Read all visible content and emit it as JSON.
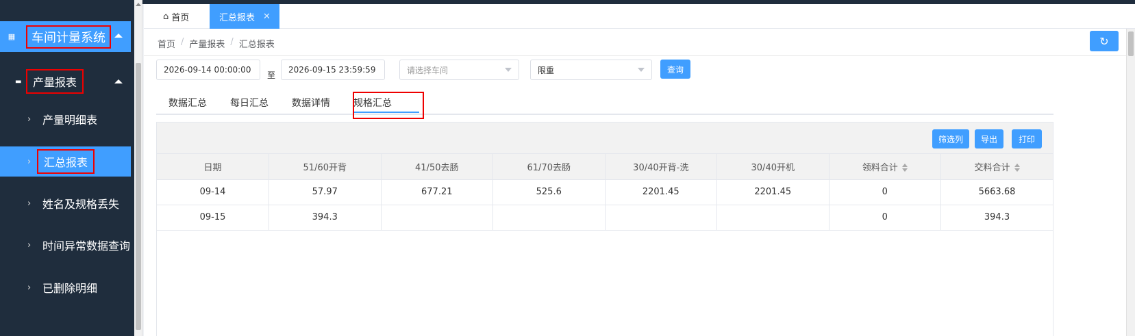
{
  "sidebar": {
    "system_title": "车间计量系统",
    "group_title": "产量报表",
    "items": [
      {
        "label": "产量明细表"
      },
      {
        "label": "汇总报表"
      },
      {
        "label": "姓名及规格丢失"
      },
      {
        "label": "时间异常数据查询"
      },
      {
        "label": "已删除明细"
      }
    ]
  },
  "tabs": {
    "home": "首页",
    "active": "汇总报表",
    "close": "✕"
  },
  "breadcrumb": [
    "首页",
    "产量报表",
    "汇总报表"
  ],
  "filters": {
    "start": "2026-09-14 00:00:00",
    "to_label": "至",
    "end": "2026-09-15 23:59:59",
    "workshop_placeholder": "请选择车间",
    "measure": "限重",
    "query_button": "查询"
  },
  "subtabs": [
    "数据汇总",
    "每日汇总",
    "数据详情",
    "规格汇总"
  ],
  "toolbar": {
    "filter_columns": "筛选列",
    "export": "导出",
    "print": "打印"
  },
  "table": {
    "headers": [
      "日期",
      "51/60开背",
      "41/50去肠",
      "61/70去肠",
      "30/40开背-洗",
      "30/40开机",
      "领料合计",
      "交料合计"
    ],
    "rows": [
      [
        "09-14",
        "57.97",
        "677.21",
        "525.6",
        "2201.45",
        "2201.45",
        "0",
        "5663.68"
      ],
      [
        "09-15",
        "394.3",
        "",
        "",
        "",
        "",
        "0",
        "394.3"
      ]
    ]
  },
  "colors": {
    "sidebar_bg": "#1f2d3d",
    "accent": "#409eff",
    "highlight_box": "#e00000"
  }
}
